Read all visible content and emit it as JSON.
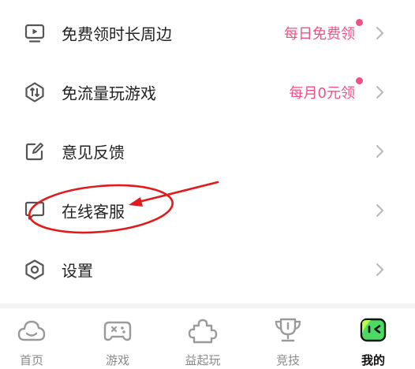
{
  "menu": {
    "items": [
      {
        "label": "免费领时长周边",
        "promo": "每日免费领",
        "icon": "tv-icon",
        "badge": true
      },
      {
        "label": "免流量玩游戏",
        "promo": "每月0元领",
        "icon": "data-saver-icon",
        "badge": true
      },
      {
        "label": "意见反馈",
        "promo": "",
        "icon": "edit-feedback-icon",
        "badge": false
      },
      {
        "label": "在线客服",
        "promo": "",
        "icon": "chat-support-icon",
        "badge": false
      },
      {
        "label": "设置",
        "promo": "",
        "icon": "settings-icon",
        "badge": false
      }
    ]
  },
  "tabbar": {
    "active_color": "#4cd964",
    "tabs": [
      {
        "label": "首页",
        "icon": "home-cloud-icon",
        "active": false
      },
      {
        "label": "游戏",
        "icon": "gamepad-icon",
        "active": false
      },
      {
        "label": "益起玩",
        "icon": "puzzle-icon",
        "active": false
      },
      {
        "label": "竞技",
        "icon": "trophy-icon",
        "active": false
      },
      {
        "label": "我的",
        "icon": "profile-face-icon",
        "active": true
      }
    ]
  },
  "colors": {
    "accent_pink": "#f0508a",
    "annotation_red": "#e01b1b"
  }
}
